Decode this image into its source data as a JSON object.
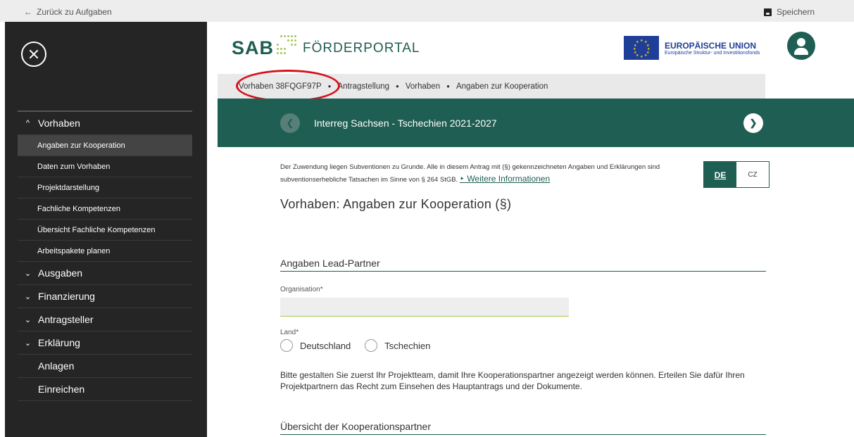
{
  "topbar": {
    "back_label": "Zurück zu Aufgaben",
    "save_label": "Speichern"
  },
  "header": {
    "logo_sab": "SAB",
    "logo_portal": "FÖRDERPORTAL",
    "eu_title": "EUROPÄISCHE UNION",
    "eu_subtitle": "Europäische Struktur- und Investitionsfonds"
  },
  "breadcrumb": [
    "Vorhaben 38FQGF97P",
    "Antragstellung",
    "Vorhaben",
    "Angaben zur Kooperation"
  ],
  "banner": {
    "title": "Interreg Sachsen - Tschechien 2021-2027"
  },
  "sidebar": {
    "sections": [
      {
        "label": "Vorhaben",
        "chevron": "^",
        "items": [
          {
            "label": "Angaben zur Kooperation",
            "active": true
          },
          {
            "label": "Daten zum Vorhaben"
          },
          {
            "label": "Projektdarstellung"
          },
          {
            "label": "Fachliche Kompetenzen"
          },
          {
            "label": "Übersicht Fachliche Kompetenzen"
          },
          {
            "label": "Arbeitspakete planen"
          }
        ]
      },
      {
        "label": "Ausgaben",
        "chevron": "⌄"
      },
      {
        "label": "Finanzierung",
        "chevron": "⌄"
      },
      {
        "label": "Antragsteller",
        "chevron": "⌄"
      },
      {
        "label": "Erklärung",
        "chevron": "⌄"
      },
      {
        "label": "Anlagen",
        "chevron": ""
      },
      {
        "label": "Einreichen",
        "chevron": ""
      }
    ]
  },
  "notice": {
    "text": "Der Zuwendung liegen Subventionen zu Grunde. Alle in diesem Antrag mit (§) gekennzeichneten Angaben und Erklärungen sind subventionserhebliche Tatsachen im Sinne von § 264 StGB.",
    "more_label": "‣ Weitere Informationen"
  },
  "lang": {
    "de": "DE",
    "cz": "CZ"
  },
  "page_title": "Vorhaben: Angaben zur Kooperation (§)",
  "lead_partner": {
    "heading": "Angaben Lead-Partner",
    "org_label": "Organisation*",
    "org_value": "",
    "land_label": "Land*",
    "options": [
      "Deutschland",
      "Tschechien"
    ]
  },
  "info_text": "Bitte gestalten Sie zuerst Ihr Projektteam, damit Ihre Kooperationspartner angezeigt werden können. Erteilen Sie dafür Ihren Projektpartnern das Recht zum Einsehen des Hauptantrags und der Dokumente.",
  "overview_heading": "Übersicht der Kooperationspartner",
  "colors": {
    "primary": "#1f5e52",
    "sidebar": "#252525",
    "accent": "#a6c85a",
    "highlight": "#d8121d",
    "eu_blue": "#1f3e98"
  }
}
